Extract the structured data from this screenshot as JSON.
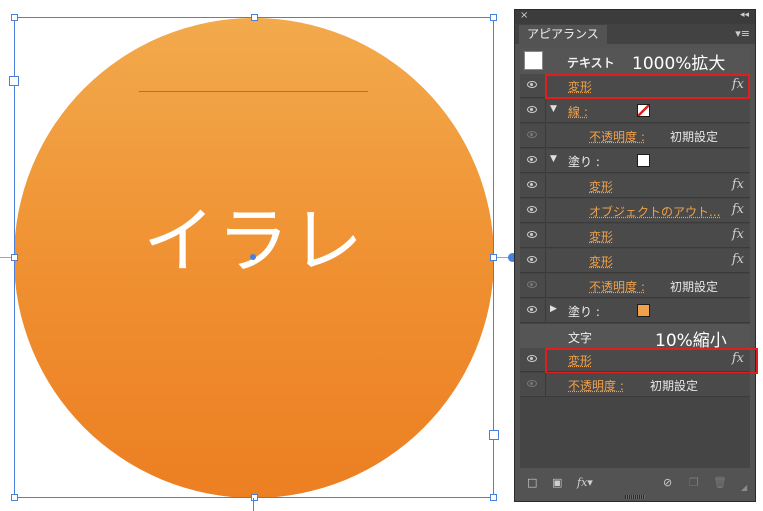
{
  "artwork": {
    "text": "イラレ"
  },
  "panel": {
    "close": "×",
    "collapse": "◂◂",
    "tab_title": "アピアランス",
    "menu": "▾≡",
    "header": {
      "label": "テキスト",
      "note": "1000%拡大"
    },
    "rows": [
      {
        "label": "変形",
        "fx": "fx"
      },
      {
        "label": "線 :"
      },
      {
        "label": "不透明度 :",
        "value": "初期設定"
      },
      {
        "label": "塗り :"
      },
      {
        "label": "変形",
        "fx": "fx"
      },
      {
        "label": "オブジェクトのアウト...",
        "fx": "fx"
      },
      {
        "label": "変形",
        "fx": "fx"
      },
      {
        "label": "変形",
        "fx": "fx"
      },
      {
        "label": "不透明度 :",
        "value": "初期設定"
      },
      {
        "label": "塗り :"
      },
      {
        "label": "文字",
        "note": "10%縮小"
      },
      {
        "label": "変形",
        "fx": "fx"
      },
      {
        "label": "不透明度 :",
        "value": "初期設定"
      }
    ],
    "colors": {
      "accent": "#f0a14a",
      "highlight": "#e01e1e",
      "fill_swatch": "#f0a14a"
    },
    "bottom": {
      "fx_label": "fx▾"
    }
  }
}
